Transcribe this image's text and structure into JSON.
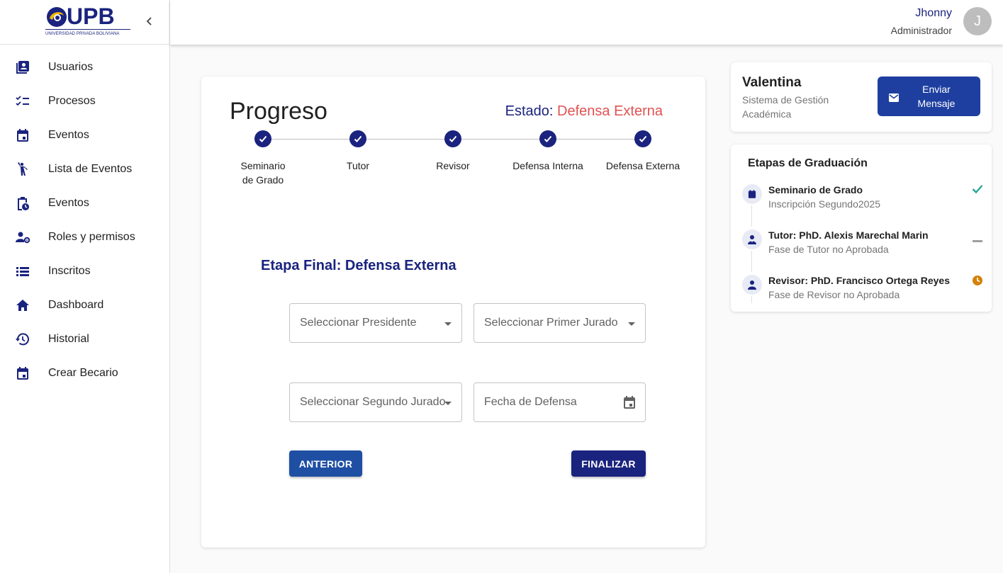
{
  "sidebar": {
    "logo_text": "UPB",
    "logo_sub": "UNIVERSIDAD PRIVADA BOLIVIANA",
    "items": [
      {
        "label": "Usuarios",
        "icon": "contacts-icon"
      },
      {
        "label": "Procesos",
        "icon": "checklist-icon"
      },
      {
        "label": "Eventos",
        "icon": "calendar-icon"
      },
      {
        "label": "Lista de Eventos",
        "icon": "person-raise-icon"
      },
      {
        "label": "Eventos",
        "icon": "clipboard-clock-icon"
      },
      {
        "label": "Roles y permisos",
        "icon": "manage-accounts-icon"
      },
      {
        "label": "Inscritos",
        "icon": "list-icon"
      },
      {
        "label": "Dashboard",
        "icon": "home-icon"
      },
      {
        "label": "Historial",
        "icon": "history-icon"
      },
      {
        "label": "Crear Becario",
        "icon": "calendar-icon"
      }
    ]
  },
  "header": {
    "user_name": "Jhonny",
    "user_role": "Administrador",
    "avatar_initial": "J"
  },
  "progress": {
    "title": "Progreso",
    "estado_label": "Estado:",
    "estado_value": "Defensa Externa",
    "steps": [
      "Seminario de Grado",
      "Tutor",
      "Revisor",
      "Defensa Interna",
      "Defensa Externa"
    ],
    "stage_title": "Etapa Final: Defensa Externa",
    "fields": {
      "presidente": "Seleccionar Presidente",
      "primer_jurado": "Seleccionar Primer Jurado",
      "segundo_jurado": "Seleccionar Segundo Jurado",
      "fecha": "Fecha de Defensa"
    },
    "btn_prev": "ANTERIOR",
    "btn_finish": "FINALIZAR"
  },
  "profile": {
    "name": "Valentina",
    "subtitle": "Sistema de Gestión Académica",
    "send_button": "Enviar Mensaje"
  },
  "graduation": {
    "title": "Etapas de Graduación",
    "stages": [
      {
        "name": "Seminario de Grado",
        "desc": "Inscripción Segundo2025",
        "status": "done"
      },
      {
        "name": "Tutor: PhD. Alexis Marechal Marin",
        "desc": "Fase de Tutor no Aprobada",
        "status": "none"
      },
      {
        "name": "Revisor: PhD. Francisco Ortega Reyes",
        "desc": "Fase de Revisor no Aprobada",
        "status": "pending"
      }
    ]
  },
  "colors": {
    "primary": "#1a237e",
    "accent_red": "#e05252",
    "success": "#26a69a",
    "pending": "#d4820a"
  }
}
